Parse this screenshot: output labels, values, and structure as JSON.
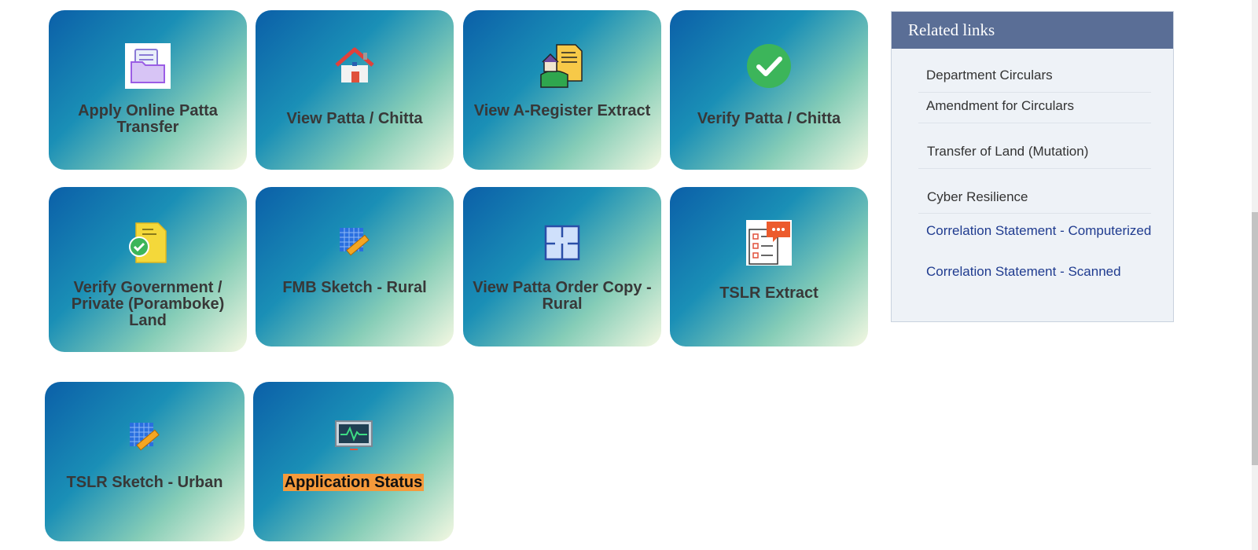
{
  "tiles": [
    {
      "label": "Apply Online Patta Transfer",
      "icon": "folder-icon"
    },
    {
      "label": "View Patta / Chitta",
      "icon": "house-icon"
    },
    {
      "label": "View A-Register Extract",
      "icon": "land-document-icon"
    },
    {
      "label": "Verify Patta / Chitta",
      "icon": "check-circle-icon"
    },
    {
      "label": "Verify Government / Private (Poramboke) Land",
      "icon": "verified-document-icon"
    },
    {
      "label": "FMB Sketch - Rural",
      "icon": "grid-ruler-icon"
    },
    {
      "label": "View Patta Order Copy - Rural",
      "icon": "floor-plan-icon"
    },
    {
      "label": "TSLR Extract",
      "icon": "checklist-chat-icon"
    },
    {
      "label": "TSLR Sketch - Urban",
      "icon": "grid-ruler-icon"
    },
    {
      "label": "Application Status",
      "icon": "monitor-pulse-icon"
    }
  ],
  "related": {
    "title": "Related links",
    "links": [
      {
        "label": "Department Circulars"
      },
      {
        "label": "Amendment for Circulars"
      },
      {
        "label": "Transfer of Land (Mutation)"
      },
      {
        "label": "Cyber Resilience"
      },
      {
        "label": "Correlation Statement - Computerized"
      },
      {
        "label": "Correlation Statement - Scanned"
      }
    ]
  },
  "colors": {
    "tile_gradient": [
      "#0b5fa8",
      "#1a8fb6",
      "#86cdb7",
      "#f4f8e2"
    ],
    "related_header": "#5a6e96",
    "highlight": "#f59a3b"
  }
}
